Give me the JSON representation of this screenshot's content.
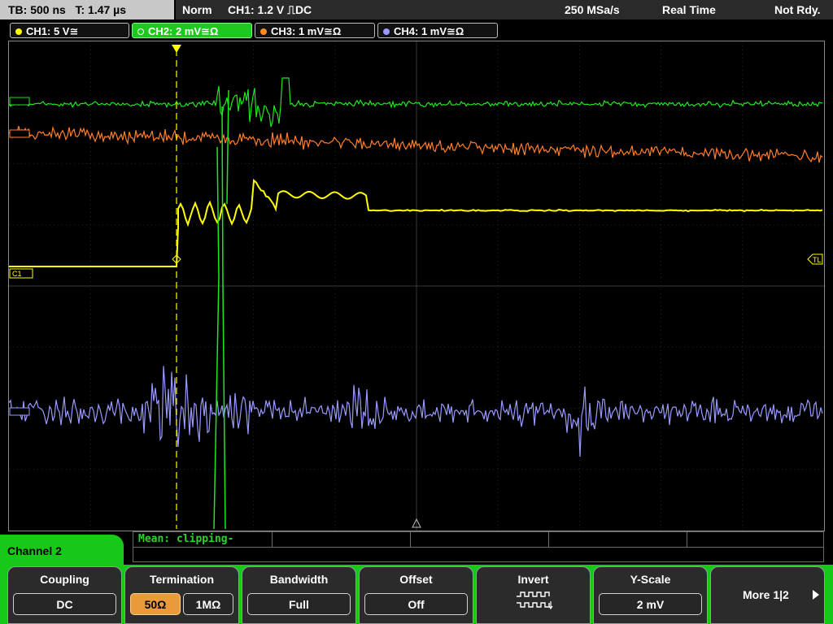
{
  "topbar": {
    "timebase": "TB: 500 ns",
    "trigger_time": "T: 1.47 µs",
    "mode": "Norm",
    "trigger_setting": "CH1: 1.2 V ⎍DC",
    "sample_rate": "250 MSa/s",
    "acq_mode": "Real Time",
    "status": "Not Rdy."
  },
  "channel_tabs": [
    {
      "label": "CH1: 5 V≅",
      "color": "#ffff00"
    },
    {
      "label": "CH2: 2 mV≅Ω",
      "color": "#00ff00"
    },
    {
      "label": "CH3: 1 mV≅Ω",
      "color": "#ff8a2b"
    },
    {
      "label": "CH4: 1 mV≅Ω",
      "color": "#9b9bff"
    }
  ],
  "screen": {
    "ch1_marker": "C1",
    "trigger_level_marker": "TL",
    "trace_colors": {
      "ch1": "#ffff00",
      "ch2": "#1ee81e",
      "ch3": "#ff7f2a",
      "ch4": "#9999ff"
    }
  },
  "measurement": {
    "text": "Mean: clipping-"
  },
  "menu": {
    "title": "Channel 2",
    "softkeys": {
      "coupling": {
        "label": "Coupling",
        "value": "DC"
      },
      "termination": {
        "label": "Termination",
        "option_a": "50Ω",
        "option_b": "1MΩ",
        "selected": "50Ω"
      },
      "bandwidth": {
        "label": "Bandwidth",
        "value": "Full"
      },
      "offset": {
        "label": "Offset",
        "value": "Off"
      },
      "invert": {
        "label": "Invert",
        "icon": "invert-waveform-icon"
      },
      "yscale": {
        "label": "Y-Scale",
        "value": "2 mV"
      },
      "more": {
        "label": "More 1|2",
        "icon": "arrow-right-icon"
      }
    }
  }
}
